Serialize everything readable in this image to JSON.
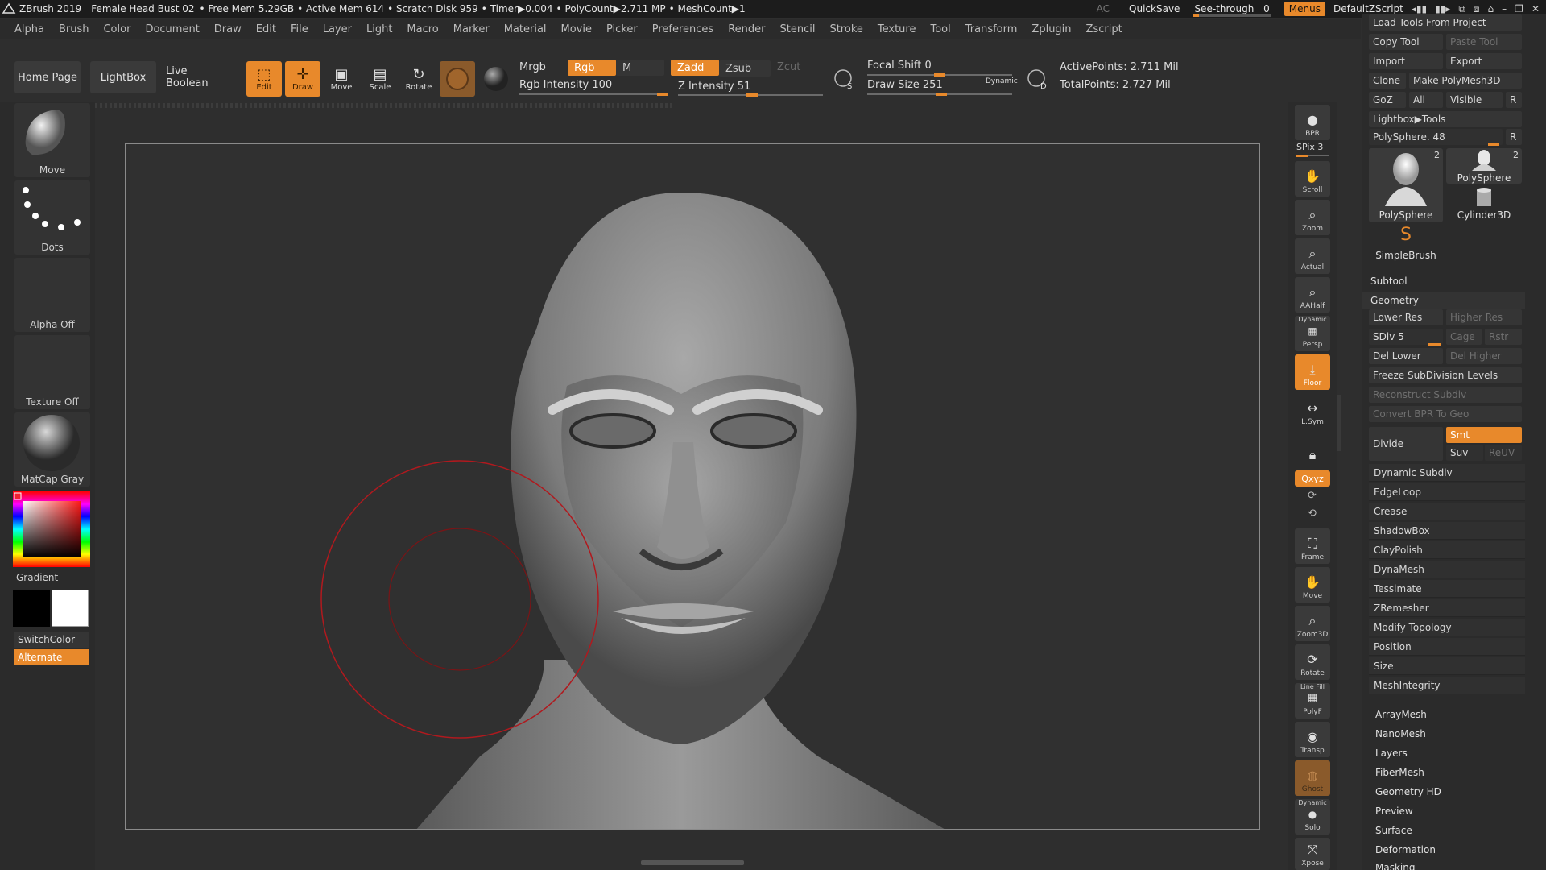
{
  "titlebar": {
    "app_name": "ZBrush 2019",
    "document": "Female Head Bust 02",
    "free_mem": "• Free Mem 5.29GB",
    "active_mem": "• Active Mem 614",
    "scratch_disk": "• Scratch Disk 959",
    "timer": "• Timer▶0.004",
    "polycount": "• PolyCount▶2.711 MP",
    "meshcount": "• MeshCount▶1",
    "ac": "AC",
    "quicksave": "QuickSave",
    "see_through": "See-through",
    "see_through_value": "0",
    "menus": "Menus",
    "default_zscript": "DefaultZScript"
  },
  "menubar": {
    "items": [
      "Alpha",
      "Brush",
      "Color",
      "Document",
      "Draw",
      "Edit",
      "File",
      "Layer",
      "Light",
      "Macro",
      "Marker",
      "Material",
      "Movie",
      "Picker",
      "Preferences",
      "Render",
      "Stencil",
      "Stroke",
      "Texture",
      "Tool",
      "Transform",
      "Zplugin",
      "Zscript"
    ]
  },
  "shelf": {
    "home_page": "Home Page",
    "lightbox": "LightBox",
    "live_boolean": "Live Boolean",
    "edit": "Edit",
    "draw": "Draw",
    "move": "Move",
    "scale": "Scale",
    "rotate": "Rotate",
    "mrgb": "Mrgb",
    "rgb": "Rgb",
    "m": "M",
    "rgb_intensity": "Rgb Intensity 100",
    "zadd": "Zadd",
    "zsub": "Zsub",
    "zcut": "Zcut",
    "z_intensity": "Z Intensity 51",
    "focal_shift": "Focal Shift 0",
    "draw_size": "Draw Size 251",
    "dynamic": "Dynamic",
    "active_points": "ActivePoints: 2.711 Mil",
    "total_points": "TotalPoints: 2.727 Mil",
    "rgb_intensity_value": 100,
    "z_intensity_value": 51
  },
  "left": {
    "brush": "Move",
    "stroke": "Dots",
    "alpha": "Alpha Off",
    "texture": "Texture Off",
    "material": "MatCap Gray",
    "gradient": "Gradient",
    "switch_color": "SwitchColor",
    "alternate": "Alternate"
  },
  "right_strip": {
    "bpr": "BPR",
    "spix": "SPix 3",
    "scroll": "Scroll",
    "zoom": "Zoom",
    "actual": "Actual",
    "aahalf": "AAHalf",
    "dynamic": "Dynamic",
    "persp": "Persp",
    "floor": "Floor",
    "lsym": "L.Sym",
    "xyz": "Qxyz",
    "frame": "Frame",
    "move": "Move",
    "zoom3d": "Zoom3D",
    "rotate": "Rotate",
    "line_fill": "Line Fill",
    "polyf": "PolyF",
    "transp": "Transp",
    "ghost": "Ghost",
    "solo_dynamic": "Dynamic",
    "solo": "Solo",
    "xpose": "Xpose"
  },
  "right_panel": {
    "load_tools": "Load Tools From Project",
    "copy_tool": "Copy Tool",
    "paste_tool": "Paste Tool",
    "import": "Import",
    "export": "Export",
    "clone": "Clone",
    "make_polymesh": "Make PolyMesh3D",
    "goz": "GoZ",
    "all": "All",
    "visible": "Visible",
    "r": "R",
    "lightbox_tools": "Lightbox▶Tools",
    "polysphere_slider": "PolySphere. 48",
    "tools": [
      {
        "name": "PolySphere",
        "count": "2"
      },
      {
        "name": "PolySphere",
        "count": "2"
      },
      {
        "name": "Cylinder3D",
        "count": ""
      },
      {
        "name": "SimpleBrush",
        "count": ""
      }
    ],
    "subtool": "Subtool",
    "geometry": "Geometry",
    "lower_res": "Lower Res",
    "higher_res": "Higher Res",
    "sdiv": "SDiv 5",
    "cage": "Cage",
    "rstr": "Rstr",
    "del_lower": "Del Lower",
    "del_higher": "Del Higher",
    "freeze_subdiv": "Freeze SubDivision Levels",
    "reconstruct_subdiv": "Reconstruct Subdiv",
    "convert_bpr": "Convert BPR To Geo",
    "divide": "Divide",
    "smt": "Smt",
    "suv": "Suv",
    "reuv": "ReUV",
    "geometry_items": [
      "Dynamic Subdiv",
      "EdgeLoop",
      "Crease",
      "ShadowBox",
      "ClayPolish",
      "DynaMesh",
      "Tessimate",
      "ZRemesher",
      "Modify Topology",
      "Position",
      "Size",
      "MeshIntegrity"
    ],
    "tool_items": [
      "ArrayMesh",
      "NanoMesh",
      "Layers",
      "FiberMesh",
      "Geometry HD",
      "Preview",
      "Surface",
      "Deformation",
      "Masking"
    ]
  }
}
